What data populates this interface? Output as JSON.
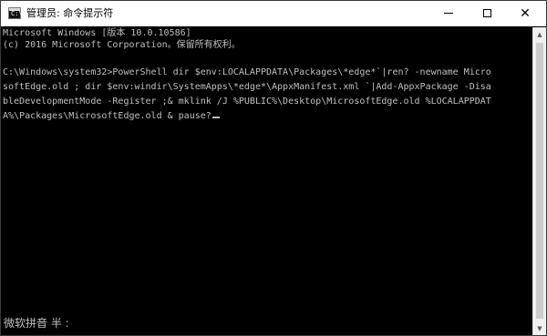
{
  "window": {
    "title": "管理员: 命令提示符",
    "icon": "cmd-icon",
    "icon_label": "C:\\",
    "controls": {
      "minimize": "minimize-icon",
      "maximize": "maximize-icon",
      "close_glyph": "✕"
    }
  },
  "console": {
    "lines": [
      "Microsoft Windows [版本 10.0.10586]",
      "(c) 2016 Microsoft Corporation。保留所有权利。",
      "C:\\Windows\\system32>PowerShell dir $env:LOCALAPPDATA\\Packages\\*edge*`|ren? -newname Micro",
      "softEdge.old ; dir $env:windir\\SystemApps\\*edge*\\AppxManifest.xml `|Add-AppxPackage -Disa",
      "bleDevelopmentMode -Register ;& mklink /J %PUBLIC%\\Desktop\\MicrosoftEdge.old %LOCALAPPDAT",
      "A%\\Packages\\MicrosoftEdge.old & pause?"
    ]
  },
  "ime": {
    "text": "微软拼音 半 :"
  },
  "scrollbar": {
    "up_glyph": "▲",
    "down_glyph": "▼"
  }
}
